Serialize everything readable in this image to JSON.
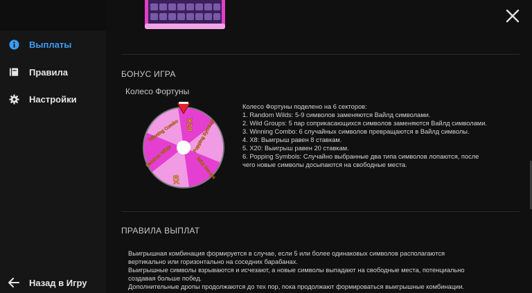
{
  "sidebar": {
    "items": [
      {
        "label": "Выплаты",
        "icon": "info-icon",
        "active": true
      },
      {
        "label": "Правила",
        "icon": "book-icon",
        "active": false
      },
      {
        "label": "Настройки",
        "icon": "gear-icon",
        "active": false
      }
    ],
    "back_label": "Назад в Игру"
  },
  "bonus": {
    "title": "БОНУС ИГРА",
    "wheel_title": "Колесо Фортуны",
    "wheel_sectors": [
      "X20",
      "Winning Combo",
      "Popping Symbols",
      "X8",
      "Random Wilds",
      "Wild Groups"
    ],
    "lines": [
      "Колесо Фортуны поделено на 6 секторов:",
      "1. Random Wilds: 5-9 символов заменяются Вайлд символами.",
      "2. Wild Groups: 5 пар соприкасающихся символов заменяются Вайлд символами.",
      "3. Winning Combo: 6 случайных символов превращаются в Вайлд символы.",
      "4. X8: Выигрыш равен 8 ставкам.",
      "5. X20: Выигрыш равен 20 ставкам.",
      "6. Popping Symbols: Случайно выбранные два типа символов лопаются, после",
      "чего новые символы досыпаются на свободные места."
    ]
  },
  "payout_rules": {
    "title": "ПРАВИЛА ВЫПЛАТ",
    "lines": [
      "Выигрышная комбинация формируется в случае, если 5 или более одинаковых символов располагаются",
      "вертикально или горизонтально на соседних барабанах.",
      "Выигрышные символы взрываются и исчезают, а новые символы выпадают на свободные места, потенциально",
      "создавая больше побед.",
      "Дополнительные дропы продолжаются до тех пор, пока продолжают формироваться выигрышные комбинации."
    ]
  },
  "colors": {
    "accent": "#3b9cf0",
    "wheel_pink": "#e43fd0",
    "wheel_light": "#f6c3ee",
    "label_gold": "#f5a623"
  }
}
